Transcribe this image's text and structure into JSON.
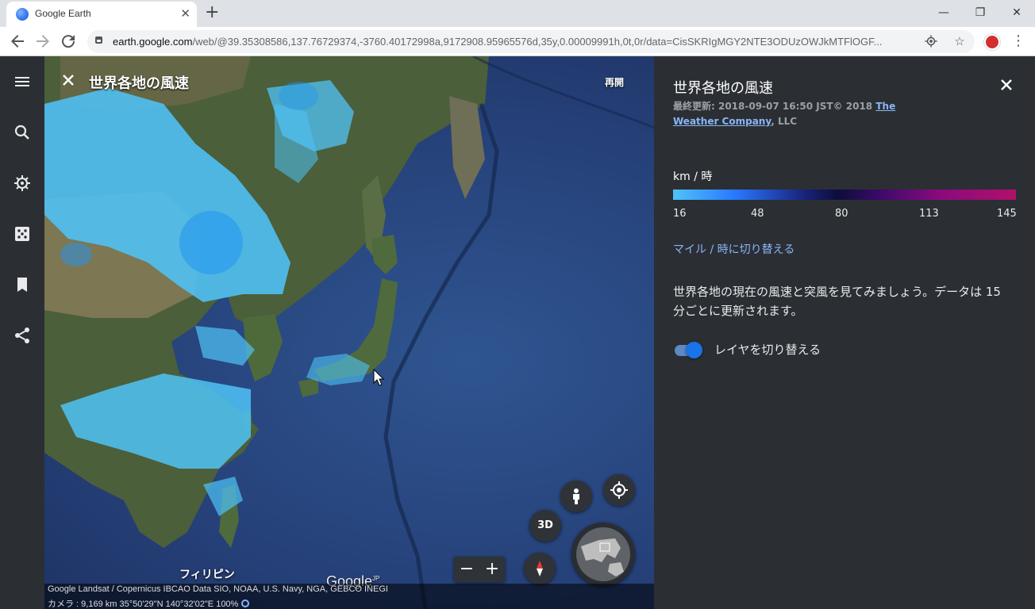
{
  "browser": {
    "tab_title": "Google Earth",
    "url_host": "earth.google.com",
    "url_path": "/web/@39.35308586,137.76729374,-3760.40172998a,9172908.95965576d,35y,0.00009991h,0t,0r/data=CisSKRIgMGY2NTE3ODUzOWJkMTFlOGF..."
  },
  "map": {
    "title": "世界各地の風速",
    "resume_label": "再開",
    "label_philippines": "フィリピン",
    "google_logo": "Google",
    "google_logo_suffix": "JP",
    "btn_3d": "3D",
    "zoom_out": "−",
    "zoom_in": "+",
    "attribution": "Google   Landsat / Copernicus   IBCAO   Data SIO, NOAA, U.S. Navy, NGA, GEBCO   INEGI",
    "camera": "カメラ :  9,169 km    35°50'29\"N 140°32'02\"E    100%"
  },
  "panel": {
    "title": "世界各地の風速",
    "updated_prefix": "最終更新: 2018-09-07 16:50 JST© 2018 ",
    "updated_link": "The Weather Company",
    "updated_suffix": ", LLC",
    "unit_label": "km / 時",
    "scale_ticks": [
      "16",
      "48",
      "80",
      "113",
      "145"
    ],
    "toggle_units": "マイル / 時に切り替える",
    "description": "世界各地の現在の風速と突風を見てみましょう。データは 15 分ごとに更新されます。",
    "layer_toggle_label": "レイヤを切り替える",
    "layer_toggle_on": true
  },
  "colors": {
    "accent": "#8ab4f8",
    "panel_bg": "#2b2f33",
    "wind_low": "#4fc3f7",
    "wind_high": "#b0106a"
  }
}
